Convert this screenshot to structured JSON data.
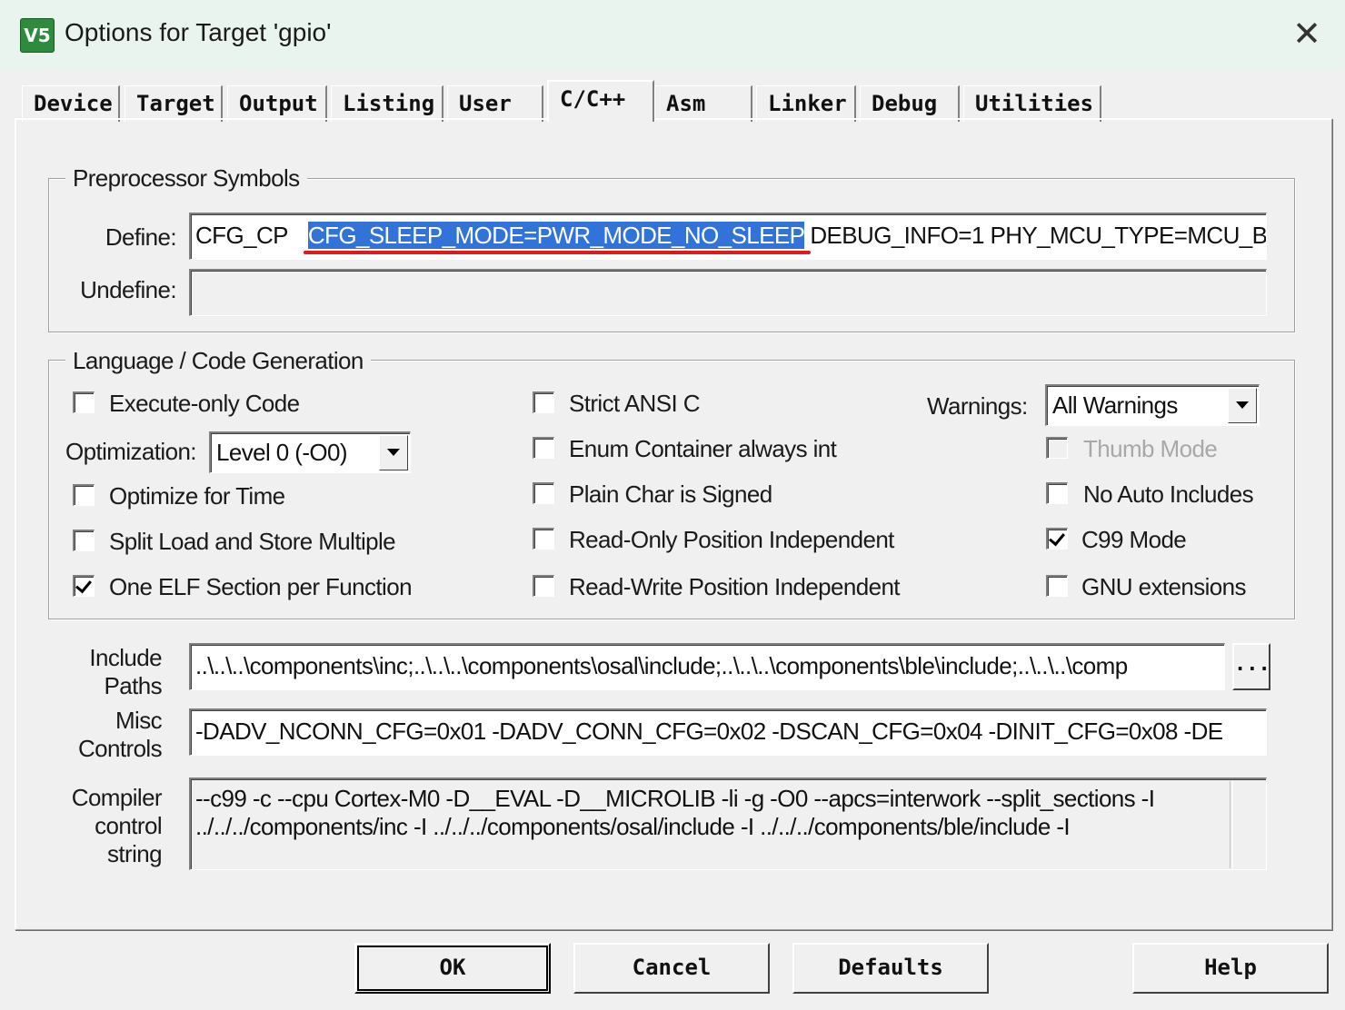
{
  "window": {
    "title": "Options for Target 'gpio'",
    "close_label": "✕",
    "app_icon": "V5"
  },
  "tabs": [
    {
      "label": "Device"
    },
    {
      "label": "Target"
    },
    {
      "label": "Output"
    },
    {
      "label": "Listing"
    },
    {
      "label": "User"
    },
    {
      "label": "C/C++",
      "active": true
    },
    {
      "label": "Asm"
    },
    {
      "label": "Linker"
    },
    {
      "label": "Debug"
    },
    {
      "label": "Utilities"
    }
  ],
  "preprocessor": {
    "legend": "Preprocessor Symbols",
    "define_label": "Define:",
    "define_before": "CFG_CP",
    "define_selected": "CFG_SLEEP_MODE=PWR_MODE_NO_SLEEP",
    "define_after": "DEBUG_INFO=1 PHY_MCU_TYPE=MCU_B",
    "undefine_label": "Undefine:",
    "undefine_value": ""
  },
  "language": {
    "legend": "Language / Code Generation",
    "execute_only": {
      "label": "Execute-only Code",
      "checked": false
    },
    "optimization_label": "Optimization:",
    "optimization_value": "Level 0 (-O0)",
    "optimize_time": {
      "label": "Optimize for Time",
      "checked": false
    },
    "split_load": {
      "label": "Split Load and Store Multiple",
      "checked": false
    },
    "one_elf": {
      "label": "One ELF Section per Function",
      "checked": true
    },
    "strict_ansi": {
      "label": "Strict ANSI C",
      "checked": false
    },
    "enum_container": {
      "label": "Enum Container always int",
      "checked": false
    },
    "plain_char": {
      "label": "Plain Char is Signed",
      "checked": false
    },
    "ropi": {
      "label": "Read-Only Position Independent",
      "checked": false
    },
    "rwpi": {
      "label": "Read-Write Position Independent",
      "checked": false
    },
    "warnings_label": "Warnings:",
    "warnings_value": "All Warnings",
    "thumb_mode": {
      "label": "Thumb Mode",
      "checked": false,
      "disabled": true
    },
    "no_auto_includes": {
      "label": "No Auto Includes",
      "checked": false
    },
    "c99_mode": {
      "label": "C99 Mode",
      "checked": true
    },
    "gnu_ext": {
      "label": "GNU extensions",
      "checked": false
    }
  },
  "paths": {
    "include_label_1": "Include",
    "include_label_2": "Paths",
    "include_value": "..\\..\\..\\components\\inc;..\\..\\..\\components\\osal\\include;..\\..\\..\\components\\ble\\include;..\\..\\..\\comp",
    "browse_label": "...",
    "misc_label_1": "Misc",
    "misc_label_2": "Controls",
    "misc_value": "-DADV_NCONN_CFG=0x01   -DADV_CONN_CFG=0x02   -DSCAN_CFG=0x04    -DINIT_CFG=0x08   -DE",
    "compiler_label_1": "Compiler",
    "compiler_label_2": "control",
    "compiler_label_3": "string",
    "compiler_line_1": "--c99 -c --cpu Cortex-M0 -D__EVAL -D__MICROLIB -li -g -O0 --apcs=interwork --split_sections -I",
    "compiler_line_2": "../../../components/inc -I ../../../components/osal/include -I ../../../components/ble/include -I"
  },
  "buttons": {
    "ok": "OK",
    "cancel": "Cancel",
    "defaults": "Defaults",
    "help": "Help"
  },
  "colors": {
    "selection": "#3173d8",
    "underline": "#e01a1a",
    "titlebar": "#eaf4ee"
  }
}
